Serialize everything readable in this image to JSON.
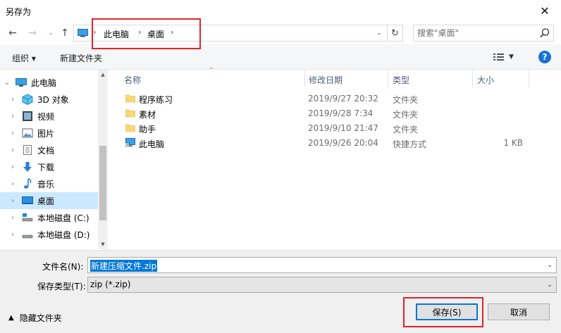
{
  "window": {
    "title": "另存为",
    "close_glyph": "✕"
  },
  "nav": {
    "back_glyph": "←",
    "forward_glyph": "→",
    "recent_glyph": "⌄",
    "up_glyph": "↑",
    "address_segments": [
      "此电脑",
      "桌面"
    ],
    "separator_glyph": "›",
    "dropdown_glyph": "⌄",
    "refresh_glyph": "↻",
    "search_placeholder": "搜索\"桌面\""
  },
  "toolbar": {
    "organize": "组织 ▾",
    "new_folder": "新建文件夹",
    "help": "?"
  },
  "sidebar": {
    "items": [
      {
        "label": "此电脑",
        "icon": "pc-icon",
        "expanded": true,
        "selected": false
      },
      {
        "label": "3D 对象",
        "icon": "3d-objects-icon",
        "selected": false
      },
      {
        "label": "视频",
        "icon": "video-icon",
        "selected": false
      },
      {
        "label": "图片",
        "icon": "pictures-icon",
        "selected": false
      },
      {
        "label": "文档",
        "icon": "documents-icon",
        "selected": false
      },
      {
        "label": "下载",
        "icon": "downloads-icon",
        "selected": false
      },
      {
        "label": "音乐",
        "icon": "music-icon",
        "selected": false
      },
      {
        "label": "桌面",
        "icon": "desktop-icon",
        "selected": true
      },
      {
        "label": "本地磁盘 (C:)",
        "icon": "drive-c-icon",
        "selected": false
      },
      {
        "label": "本地磁盘 (D:)",
        "icon": "drive-d-icon",
        "selected": false
      }
    ]
  },
  "file_list": {
    "columns": [
      "名称",
      "修改日期",
      "类型",
      "大小"
    ],
    "sort_glyph": "^",
    "rows": [
      {
        "name": "程序练习",
        "date": "2019/9/27 20:32",
        "type": "文件夹",
        "size": "",
        "icon": "folder-icon"
      },
      {
        "name": "素材",
        "date": "2019/9/28 7:34",
        "type": "文件夹",
        "size": "",
        "icon": "folder-icon"
      },
      {
        "name": "助手",
        "date": "2019/9/10 21:47",
        "type": "文件夹",
        "size": "",
        "icon": "folder-icon"
      },
      {
        "name": "此电脑",
        "date": "2019/9/26 20:04",
        "type": "快捷方式",
        "size": "1 KB",
        "icon": "shortcut-pc-icon"
      }
    ]
  },
  "save": {
    "filename_label": "文件名(N):",
    "filename_value": "新建压缩文件.zip",
    "filetype_label": "保存类型(T):",
    "filetype_value": "zip (*.zip)",
    "hide_folders": "隐藏文件夹",
    "save_button": "保存(S)",
    "cancel_button": "取消"
  },
  "colors": {
    "accent": "#0078d7",
    "selection": "#cce8ff",
    "highlight_box": "#e0222a",
    "folder": "#f8d775"
  }
}
